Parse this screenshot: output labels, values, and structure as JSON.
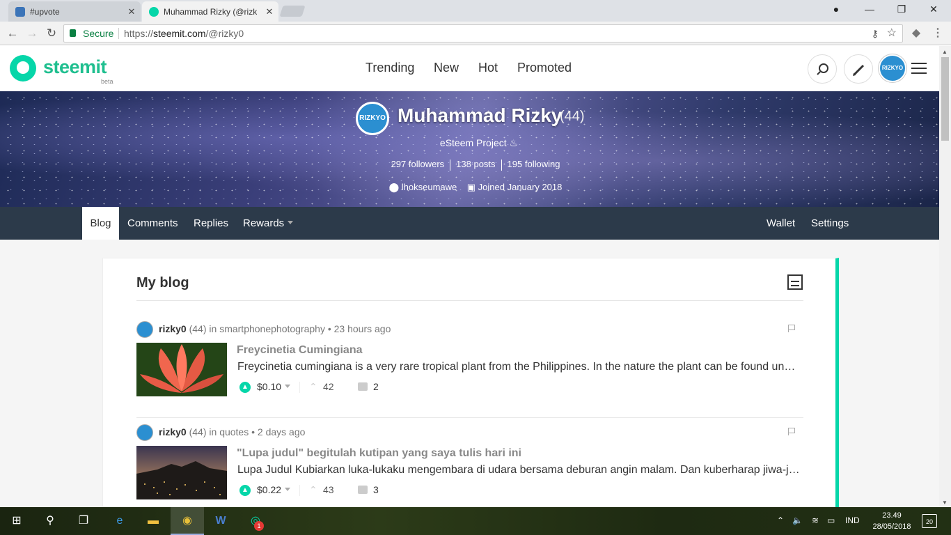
{
  "browser": {
    "tabs": [
      {
        "title": "#upvote",
        "favicon_color": "#3b74b8"
      },
      {
        "title": "Muhammad Rizky (@rizk",
        "favicon_color": "#06d6a9"
      }
    ],
    "secure_label": "Secure",
    "url_scheme": "https://",
    "url_host": "steemit.com",
    "url_path": "/@rizky0"
  },
  "steemit": {
    "brand": "steemit",
    "beta": "beta",
    "nav": [
      "Trending",
      "New",
      "Hot",
      "Promoted"
    ],
    "avatar_text": "RIZKYO"
  },
  "profile": {
    "name": "Muhammad Rizky",
    "reputation": "(44)",
    "about": "eSteem Project ♨",
    "followers": "297 followers",
    "posts": "138 posts",
    "following": "195 following",
    "location": "lhokseumawe",
    "joined": "Joined January 2018",
    "avatar_text": "RIZKYO"
  },
  "tabs": {
    "blog": "Blog",
    "comments": "Comments",
    "replies": "Replies",
    "rewards": "Rewards",
    "wallet": "Wallet",
    "settings": "Settings"
  },
  "blog": {
    "heading": "My blog",
    "posts": [
      {
        "author": "rizky0",
        "rep": "(44)",
        "in": "in",
        "category": "smartphonephotography",
        "time": "• 23 hours ago",
        "title": "Freycinetia Cumingiana",
        "body": "Freycinetia cumingiana is a very rare tropical plant from the Philippines. In the nature the plant can be found under cultivation in gardens",
        "payout": "$0.10",
        "votes": "42",
        "comments": "2"
      },
      {
        "author": "rizky0",
        "rep": "(44)",
        "in": "in",
        "category": "quotes",
        "time": "• 2 days ago",
        "title": "\"Lupa judul\" begitulah kutipan yang saya tulis hari ini",
        "body": "Lupa Judul Kubiarkan luka-lukaku mengembara di udara bersama deburan angin malam. Dan kuberharap jiwa-jiwa yang",
        "payout": "$0.22",
        "votes": "43",
        "comments": "3"
      }
    ]
  },
  "taskbar": {
    "lang": "IND",
    "time": "23.49",
    "date": "28/05/2018",
    "notifications": "20",
    "badge": "1"
  },
  "colors": {
    "accent": "#06d6a9",
    "subnav": "#2c3a4a"
  }
}
